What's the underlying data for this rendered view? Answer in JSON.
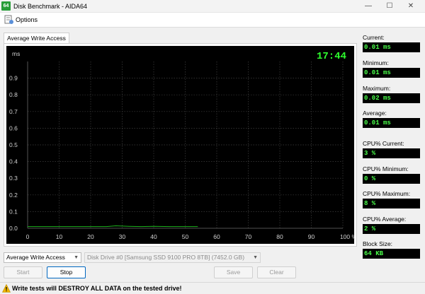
{
  "window": {
    "title": "Disk Benchmark - AIDA64",
    "app_icon_text": "64",
    "minimize_glyph": "—",
    "maximize_glyph": "☐",
    "close_glyph": "✕"
  },
  "menu": {
    "options_label": "Options",
    "options_icon": "options-icon"
  },
  "tab": {
    "label": "Average Write Access"
  },
  "chart_data": {
    "type": "line",
    "title": "",
    "clock": "17:44",
    "ylabel": "ms",
    "xlabel": "",
    "ylim": [
      0,
      1
    ],
    "xlim": [
      0,
      100
    ],
    "y_ticks": [
      "0.0",
      "0.1",
      "0.2",
      "0.3",
      "0.4",
      "0.5",
      "0.6",
      "0.7",
      "0.8",
      "0.9"
    ],
    "x_ticks": [
      "0",
      "10",
      "20",
      "30",
      "40",
      "50",
      "60",
      "70",
      "80",
      "90",
      "100 %"
    ],
    "grid": true,
    "background": "#000000",
    "grid_color": "#3f3f3f",
    "line_color": "#1db31d",
    "clock_color": "#2eff2e",
    "series": [
      {
        "x": [
          0,
          5,
          10,
          15,
          20,
          25,
          28,
          32,
          36,
          40,
          45,
          50,
          54
        ],
        "y": [
          0.01,
          0.01,
          0.01,
          0.01,
          0.01,
          0.01,
          0.015,
          0.012,
          0.01,
          0.012,
          0.01,
          0.01,
          0.01
        ]
      }
    ]
  },
  "stats": [
    {
      "label": "Current:",
      "value": "0.01 ms"
    },
    {
      "label": "Minimum:",
      "value": "0.01 ms"
    },
    {
      "label": "Maximum:",
      "value": "0.02 ms"
    },
    {
      "label": "Average:",
      "value": "0.01 ms"
    },
    {
      "label": "CPU% Current:",
      "value": "3 %"
    },
    {
      "label": "CPU% Minimum:",
      "value": "0 %"
    },
    {
      "label": "CPU% Maximum:",
      "value": "8 %"
    },
    {
      "label": "CPU% Average:",
      "value": "2 %"
    },
    {
      "label": "Block Size:",
      "value": "64 KB"
    }
  ],
  "controls": {
    "test_select": "Average Write Access",
    "drive_select": "Disk Drive #0  [Samsung SSD 9100 PRO 8TB]  (7452.0 GB)",
    "start_label": "Start",
    "stop_label": "Stop",
    "save_label": "Save",
    "clear_label": "Clear"
  },
  "status": {
    "warning_text": "Write tests will DESTROY ALL DATA on the tested drive!",
    "warning_icon": "warning-icon"
  },
  "colors": {
    "value_text": "#4aff4a",
    "accent": "#0067c0",
    "warning": "#f2b600"
  }
}
